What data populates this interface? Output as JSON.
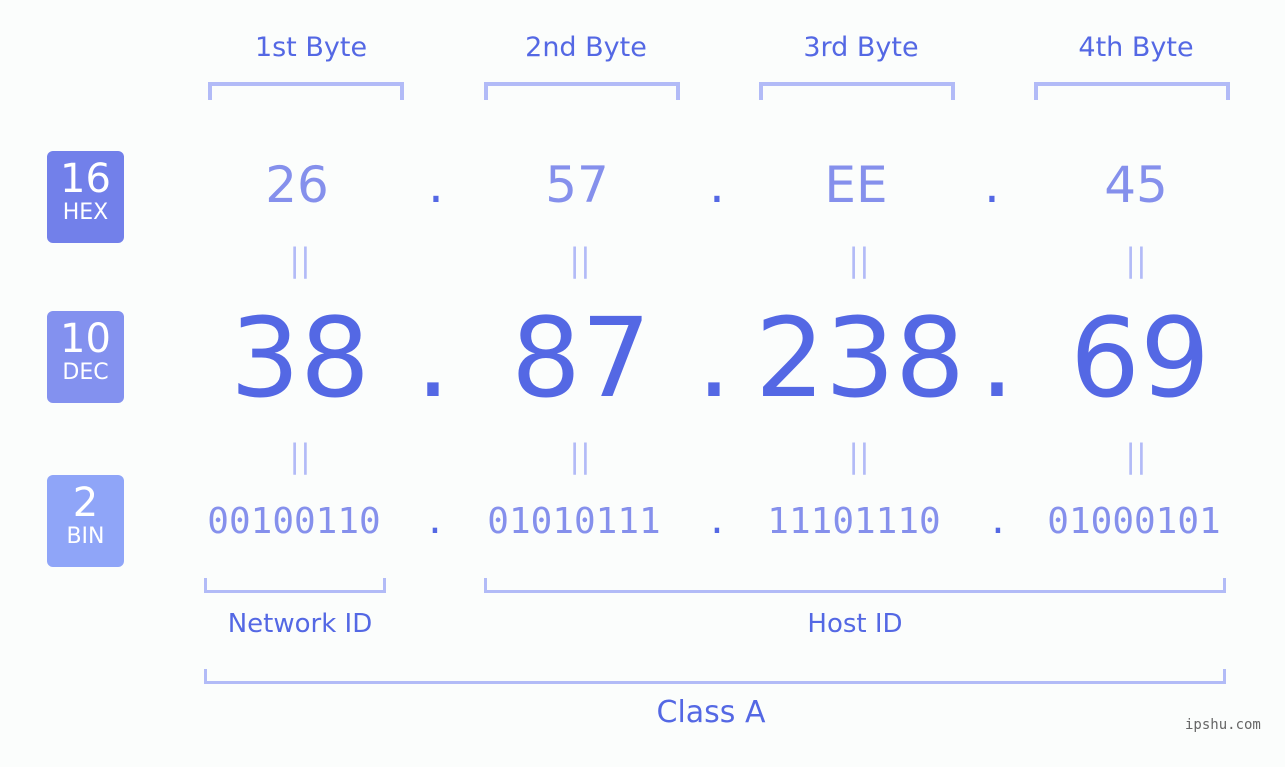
{
  "bytes": [
    {
      "label": "1st Byte",
      "hex": "26",
      "dec": "38",
      "bin": "00100110"
    },
    {
      "label": "2nd Byte",
      "hex": "57",
      "dec": "87",
      "bin": "01010111"
    },
    {
      "label": "3rd Byte",
      "hex": "EE",
      "dec": "238",
      "bin": "11101110"
    },
    {
      "label": "4th Byte",
      "hex": "45",
      "dec": "69",
      "bin": "01000101"
    }
  ],
  "separator": ".",
  "equals": "||",
  "bases": {
    "hex": {
      "num": "16",
      "label": "HEX",
      "color": "#7280ea"
    },
    "dec": {
      "num": "10",
      "label": "DEC",
      "color": "#8391ef"
    },
    "bin": {
      "num": "2",
      "label": "BIN",
      "color": "#8fa5f8"
    }
  },
  "segments": {
    "network": "Network ID",
    "host": "Host ID",
    "class": "Class A"
  },
  "watermark": "ipshu.com",
  "colors": {
    "accent": "#5468e4",
    "light": "#8590ec",
    "bracket": "#b2bbf7"
  }
}
